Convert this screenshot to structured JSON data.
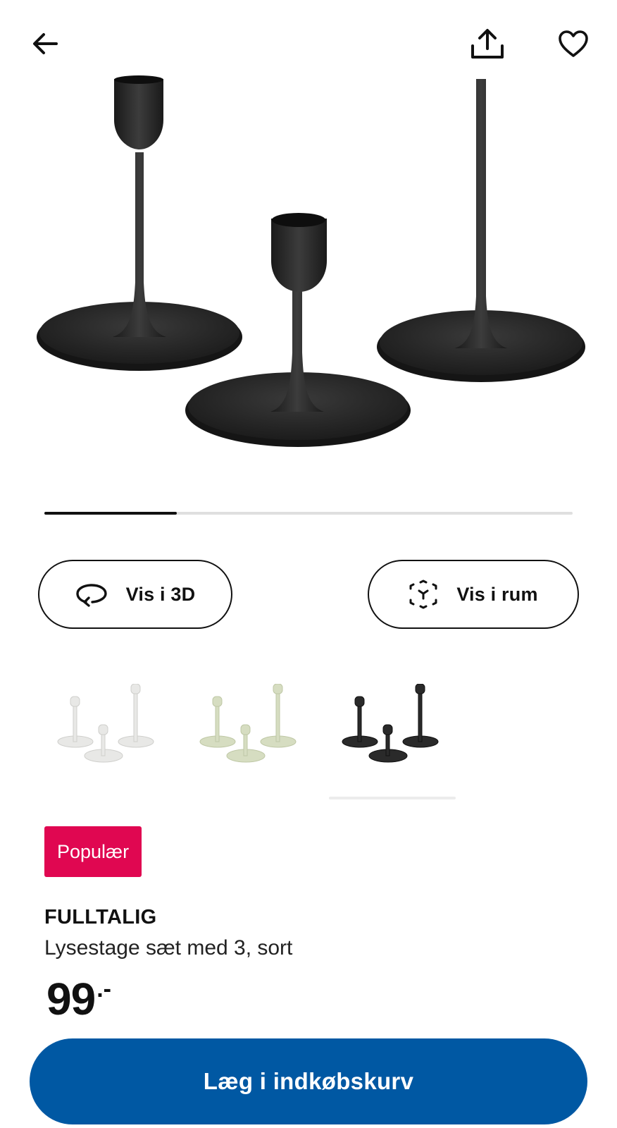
{
  "header": {
    "back_icon": "arrow-left-icon",
    "share_icon": "share-icon",
    "favourite_icon": "heart-icon"
  },
  "gallery": {
    "image": "black-candlestick-set-photo",
    "progress_fraction": 0.25
  },
  "actions": {
    "view_3d_label": "Vis i 3D",
    "view_3d_icon": "rotate-3d-icon",
    "view_room_label": "Vis i rum",
    "view_room_icon": "ar-cube-icon"
  },
  "variants": [
    {
      "color_name": "white",
      "hex": "#e6e6e4",
      "selected": false
    },
    {
      "color_name": "green",
      "hex": "#d8dec3",
      "selected": false
    },
    {
      "color_name": "black",
      "hex": "#2a2a2a",
      "selected": true
    }
  ],
  "product": {
    "badge": "Populær",
    "name": "FULLTALIG",
    "description": "Lysestage sæt med 3, sort",
    "price_integer": "99",
    "price_suffix": ".-"
  },
  "cart": {
    "button_label": "Læg i indkøbskurv"
  },
  "colors": {
    "primary_button": "#0058a3",
    "badge": "#e00751",
    "text": "#111111"
  }
}
